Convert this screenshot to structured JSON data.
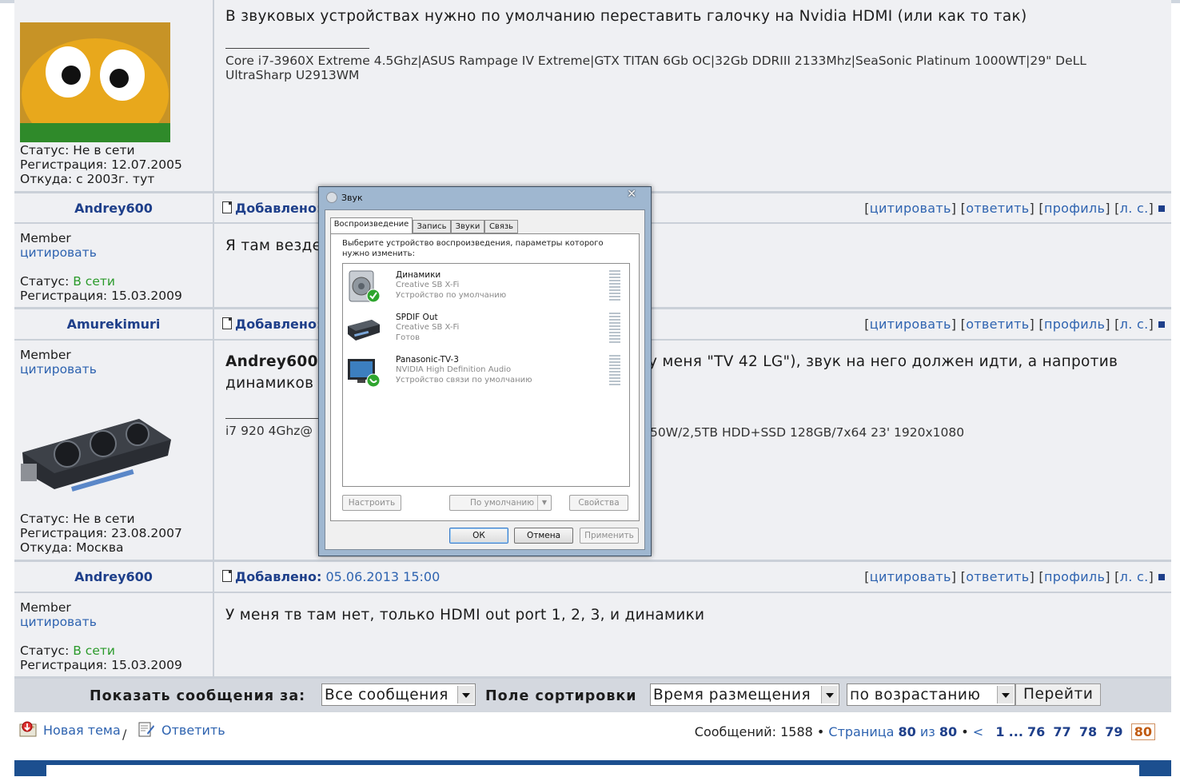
{
  "posts": [
    {
      "message": "В звуковых устройствах нужно по умолчанию переставить галочку на Nvidia HDMI (или как то так)",
      "signature": "Core i7-3960X Extreme 4.5Ghz|ASUS Rampage IV Extreme|GTX TITAN 6Gb OC|32Gb DDRIII 2133Mhz|SeaSonic Platinum 1000WT|29\" DeLL UltraSharp U2913WM",
      "status_label": "Статус:",
      "status": "Не в сети",
      "reg_label": "Регистрация:",
      "registered": "12.07.2005",
      "from_label": "Откуда:",
      "from": "с 2003г. тут"
    },
    {
      "username": "Andrey600",
      "added_label": "Добавлено:",
      "rank": "Member",
      "quote_link": "цитировать",
      "message": "Я там везде",
      "status_label": "Статус:",
      "status": "В сети",
      "reg_label": "Регистрация:",
      "registered": "15.03.2009"
    },
    {
      "username": "Amurekimuri",
      "added_label": "Добавлено:",
      "rank": "Member",
      "quote_link": "цитировать",
      "message_bold": "Andrey600",
      "message_right": "у меня \"TV 42 LG\"), звук на него должен идти, а напротив",
      "message_line2": "динамиков",
      "signature_left": "i7 920 4Ghz@",
      "signature_right": "50W/2,5TB HDD+SSD 128GB/7x64 23' 1920x1080",
      "status_label": "Статус:",
      "status": "Не в сети",
      "reg_label": "Регистрация:",
      "registered": "23.08.2007",
      "from_label": "Откуда:",
      "from": "Москва"
    },
    {
      "username": "Andrey600",
      "added_label": "Добавлено:",
      "added_date": "05.06.2013 15:00",
      "rank": "Member",
      "quote_link": "цитировать",
      "message": "У меня тв там нет, только HDMI out port 1, 2, 3, и динамики",
      "status_label": "Статус:",
      "status": "В сети",
      "reg_label": "Регистрация:",
      "registered": "15.03.2009"
    }
  ],
  "actions": {
    "quote": "цитировать",
    "reply": "ответить",
    "profile": "профиль",
    "pm": "л. с."
  },
  "filter_bar": {
    "show_label": "Показать сообщения за:",
    "show_value": "Все сообщения",
    "sort_label": "Поле сортировки",
    "sort_value": "Время размещения",
    "order_value": "по возрастанию",
    "go_button": "Перейти"
  },
  "bottom": {
    "new_topic": "Новая тема",
    "separator": "/",
    "reply": "Ответить",
    "messages_label": "Сообщений:",
    "messages_count": "1588",
    "page_label": "Страница",
    "page_current": "80",
    "page_of": "из",
    "page_total": "80",
    "prev": "<",
    "pages": [
      "1",
      "...",
      "76",
      "77",
      "78",
      "79"
    ],
    "current_page": "80"
  },
  "sound_dialog": {
    "title": "Звук",
    "close": "✕",
    "tabs": [
      "Воспроизведение",
      "Запись",
      "Звуки",
      "Связь"
    ],
    "description": "Выберите устройство воспроизведения, параметры которого нужно изменить:",
    "devices": [
      {
        "name": "Динамики",
        "driver": "Creative SB X-Fi",
        "state": "Устройство по умолчанию",
        "icon": "speaker-icon"
      },
      {
        "name": "SPDIF Out",
        "driver": "Creative SB X-Fi",
        "state": "Готов",
        "icon": "receiver-icon"
      },
      {
        "name": "Panasonic-TV-3",
        "driver": "NVIDIA High Definition Audio",
        "state": "Устройство связи по умолчанию",
        "icon": "tv-icon"
      }
    ],
    "configure_button": "Настроить",
    "default_button": "По умолчанию",
    "properties_button": "Свойства",
    "ok_button": "ОК",
    "cancel_button": "Отмена",
    "apply_button": "Применить"
  },
  "colors": {
    "link": "#2e63b0",
    "username": "#1e3f8a",
    "online": "#2a9a2a",
    "post_bg": "#eff0f3",
    "footer": "#1c4f8f"
  }
}
